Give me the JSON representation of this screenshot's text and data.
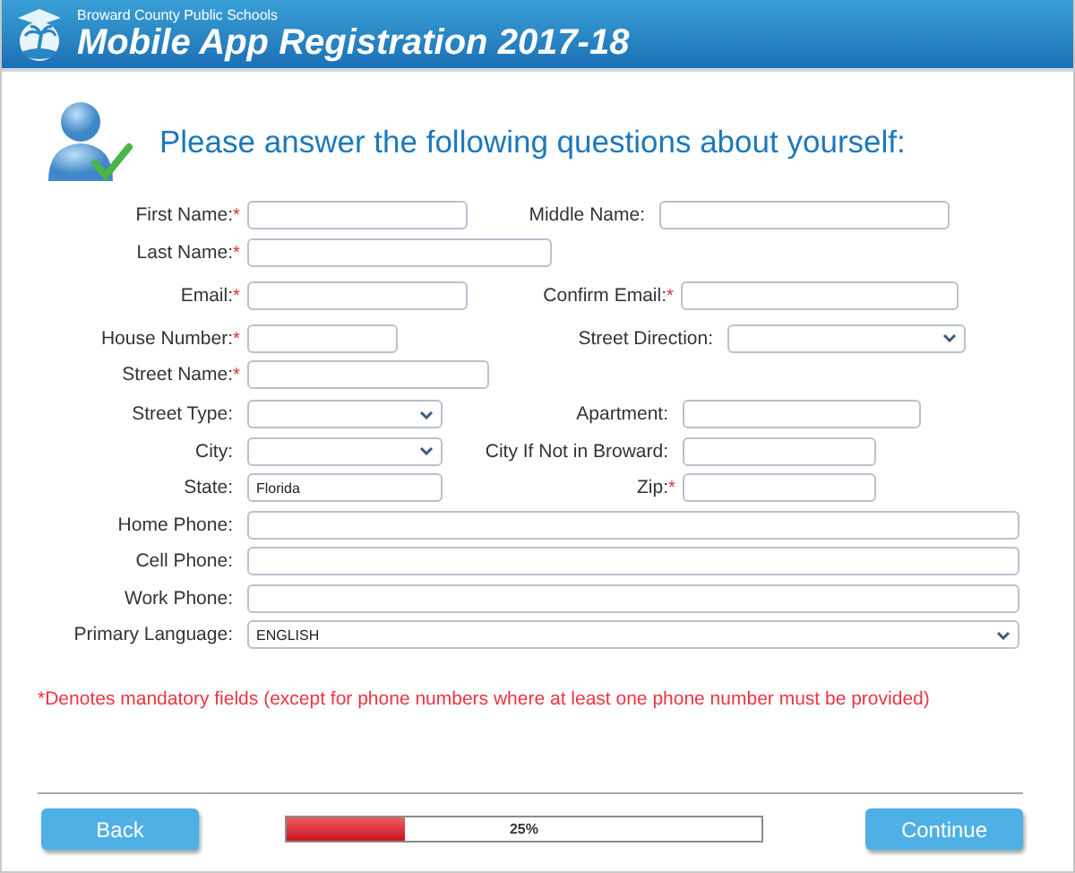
{
  "header": {
    "org": "Broward County Public Schools",
    "title": "Mobile App Registration 2017-18"
  },
  "heading": "Please answer the following questions about yourself:",
  "rows": [
    {
      "left": {
        "label": "First Name:",
        "required_mark": "*",
        "kind": "text"
      },
      "right": {
        "label": "Middle Name:",
        "kind": "text"
      }
    },
    {
      "left": {
        "label": "Last Name:",
        "required_mark": "*",
        "kind": "text"
      }
    },
    {
      "left": {
        "label": "Email:",
        "required_mark": "*",
        "kind": "text"
      },
      "right": {
        "label": "Confirm Email:",
        "required_mark": "*",
        "kind": "text"
      }
    },
    {
      "left": {
        "label": "House Number:",
        "required_mark": "*",
        "kind": "text"
      },
      "right": {
        "label": "Street Direction:",
        "kind": "select"
      }
    },
    {
      "left": {
        "label": "Street Name:",
        "required_mark": "*",
        "kind": "text"
      }
    },
    {
      "left": {
        "label": "Street Type:",
        "kind": "select"
      },
      "right": {
        "label": "Apartment:",
        "kind": "text"
      }
    },
    {
      "left": {
        "label": "City:",
        "kind": "select"
      },
      "right": {
        "label": "City If Not in Broward:",
        "kind": "text"
      }
    },
    {
      "left": {
        "label": "State:",
        "kind": "text",
        "value": "Florida"
      },
      "right": {
        "label": "Zip:",
        "required_mark": "*",
        "kind": "text"
      }
    },
    {
      "left": {
        "label": "Home Phone:",
        "kind": "text"
      }
    },
    {
      "left": {
        "label": "Cell Phone:",
        "kind": "text"
      }
    },
    {
      "left": {
        "label": "Work Phone:",
        "kind": "text"
      }
    },
    {
      "left": {
        "label": "Primary Language:",
        "kind": "select",
        "value": "ENGLISH"
      }
    }
  ],
  "note": "*Denotes mandatory fields (except for phone numbers where at least one phone number must be provided)",
  "back": "Back",
  "progress": {
    "level": 0.25,
    "text": "25%"
  },
  "continue": "Continue"
}
